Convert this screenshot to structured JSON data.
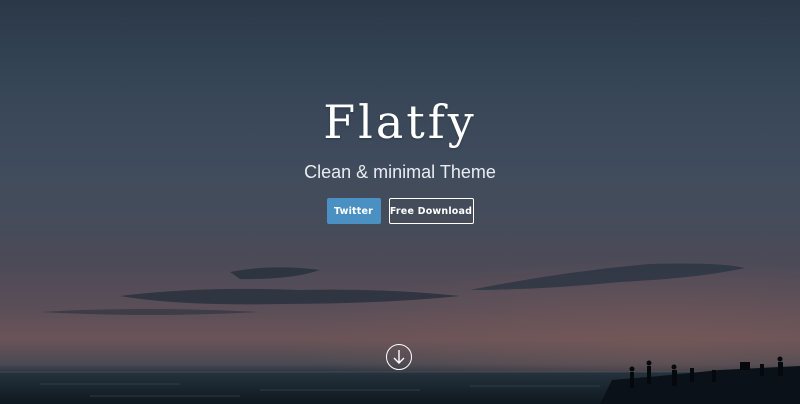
{
  "hero": {
    "title": "Flatfy",
    "tagline": "Clean & minimal Theme",
    "background": "dusk-beach-photo"
  },
  "buttons": {
    "twitter_label": "Twitter",
    "download_label": "Free Download"
  },
  "scroll": {
    "icon": "arrow-down-circle-icon"
  },
  "colors": {
    "primary_button": "#4a90c2",
    "text": "#ffffff",
    "sky_top": "#2a3848",
    "sky_horizon": "#6a5458",
    "sea": "#0f1b25"
  }
}
